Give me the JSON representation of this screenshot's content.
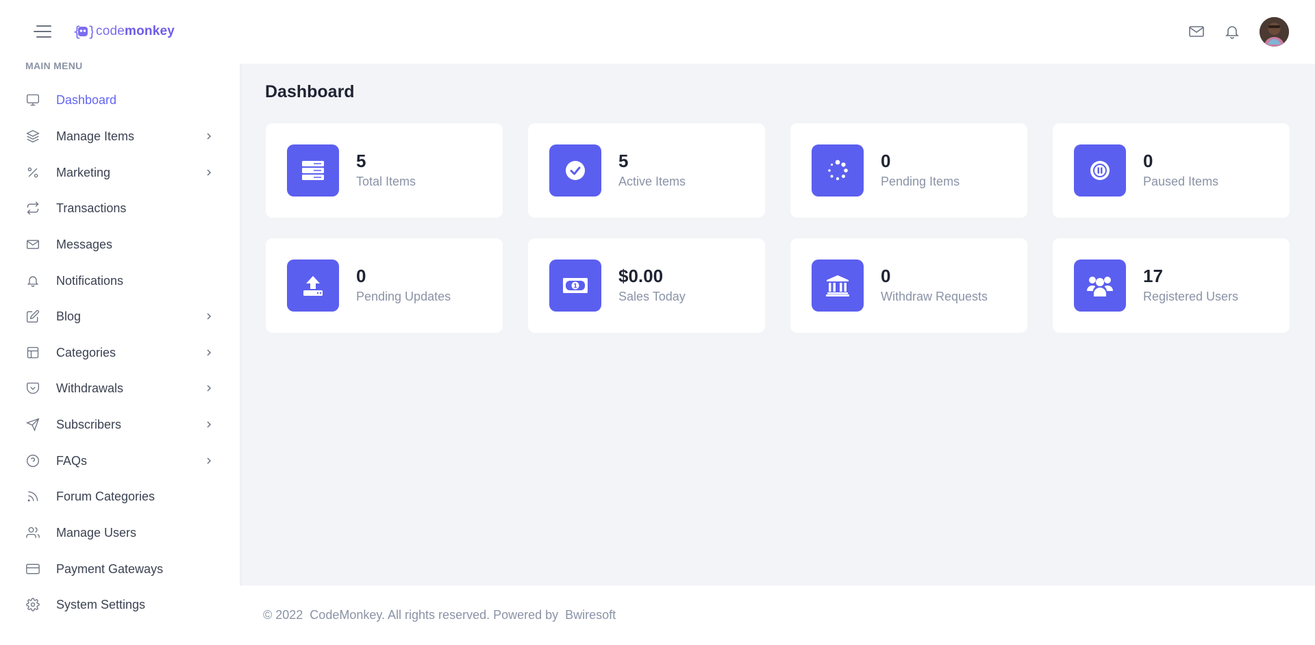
{
  "header": {
    "logo_text_light": "code",
    "logo_text_bold": "monkey",
    "icons": [
      "menu-icon",
      "mail-icon",
      "bell-icon"
    ],
    "accent": "#6366f1"
  },
  "sidebar": {
    "section_label": "MAIN MENU",
    "items": [
      {
        "label": "Dashboard",
        "icon": "monitor-icon",
        "active": true,
        "submenu": false
      },
      {
        "label": "Manage Items",
        "icon": "layers-icon",
        "submenu": true
      },
      {
        "label": "Marketing",
        "icon": "percent-icon",
        "submenu": true
      },
      {
        "label": "Transactions",
        "icon": "repeat-icon",
        "submenu": false
      },
      {
        "label": "Messages",
        "icon": "mail-icon",
        "submenu": false
      },
      {
        "label": "Notifications",
        "icon": "bell-icon",
        "submenu": false
      },
      {
        "label": "Blog",
        "icon": "edit-icon",
        "submenu": true
      },
      {
        "label": "Categories",
        "icon": "layout-icon",
        "submenu": true
      },
      {
        "label": "Withdrawals",
        "icon": "pocket-icon",
        "submenu": true
      },
      {
        "label": "Subscribers",
        "icon": "send-icon",
        "submenu": true
      },
      {
        "label": "FAQs",
        "icon": "help-circle-icon",
        "submenu": true
      },
      {
        "label": "Forum Categories",
        "icon": "rss-icon",
        "submenu": false
      },
      {
        "label": "Manage Users",
        "icon": "users-icon",
        "submenu": false
      },
      {
        "label": "Payment Gateways",
        "icon": "credit-card-icon",
        "submenu": false
      },
      {
        "label": "System Settings",
        "icon": "settings-icon",
        "submenu": false
      }
    ]
  },
  "main": {
    "title": "Dashboard",
    "stats": [
      {
        "value": "5",
        "label": "Total Items",
        "icon": "server-icon"
      },
      {
        "value": "5",
        "label": "Active Items",
        "icon": "check-circle-icon"
      },
      {
        "value": "0",
        "label": "Pending Items",
        "icon": "spinner-icon"
      },
      {
        "value": "0",
        "label": "Paused Items",
        "icon": "pause-circle-icon"
      },
      {
        "value": "0",
        "label": "Pending Updates",
        "icon": "upload-icon"
      },
      {
        "value": "$0.00",
        "label": "Sales Today",
        "icon": "money-bill-icon"
      },
      {
        "value": "0",
        "label": "Withdraw Requests",
        "icon": "bank-icon"
      },
      {
        "value": "17",
        "label": "Registered Users",
        "icon": "users-group-icon"
      }
    ]
  },
  "footer": {
    "text": "© 2022  CodeMonkey. All rights reserved. Powered by  Bwiresoft"
  }
}
